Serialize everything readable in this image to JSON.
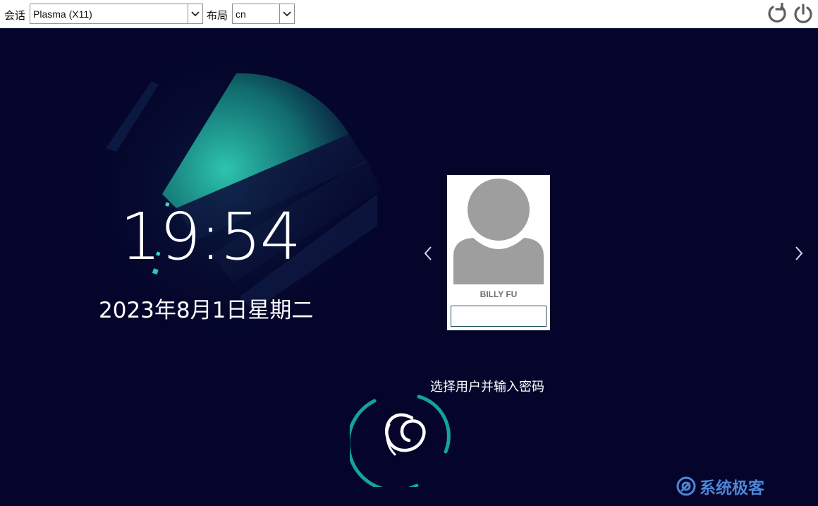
{
  "topbar": {
    "session_label": "会话",
    "session_value": "Plasma (X11)",
    "layout_label": "布局",
    "layout_value": "cn",
    "icons": [
      "reboot-icon",
      "power-icon"
    ]
  },
  "clock": {
    "time": "19:54",
    "date": "2023年8月1日星期二"
  },
  "user": {
    "name": "BILLY FU",
    "password": ""
  },
  "prompt": "选择用户并输入密码",
  "watermark": "系统极客",
  "colors": {
    "background": "#05052b",
    "accent": "#14a39a",
    "watermark": "#4d86d6"
  }
}
